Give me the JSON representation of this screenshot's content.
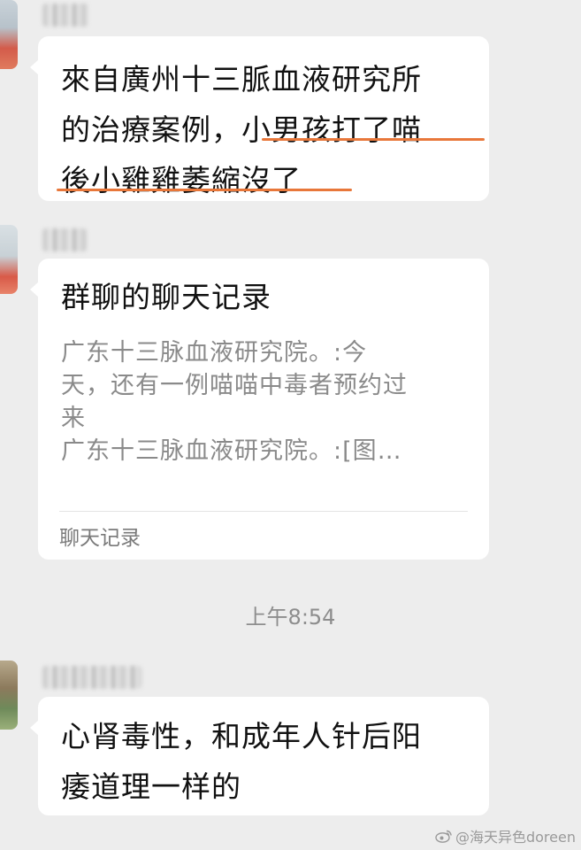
{
  "messages": [
    {
      "text": "來自廣州十三脈血液研究所\n的治療案例，小男孩打了喵\n後小雞雞萎縮沒了"
    },
    {
      "card": {
        "title": "群聊的聊天记录",
        "summary": "广东十三脉血液研究院。:今\n天，还有一例喵喵中毒者预约过\n来\n广东十三脉血液研究院。:[图…",
        "footer": "聊天记录"
      }
    },
    {
      "text": "心肾毒性，和成年人针后阳\n痿道理一样的"
    }
  ],
  "timestamp": "上午8:54",
  "watermark": {
    "text": "@海天异色doreen",
    "icon": "weibo-icon"
  },
  "colors": {
    "background": "#ededed",
    "bubble": "#ffffff",
    "underline": "#e8773a",
    "secondary_text": "#8a8a8a"
  }
}
